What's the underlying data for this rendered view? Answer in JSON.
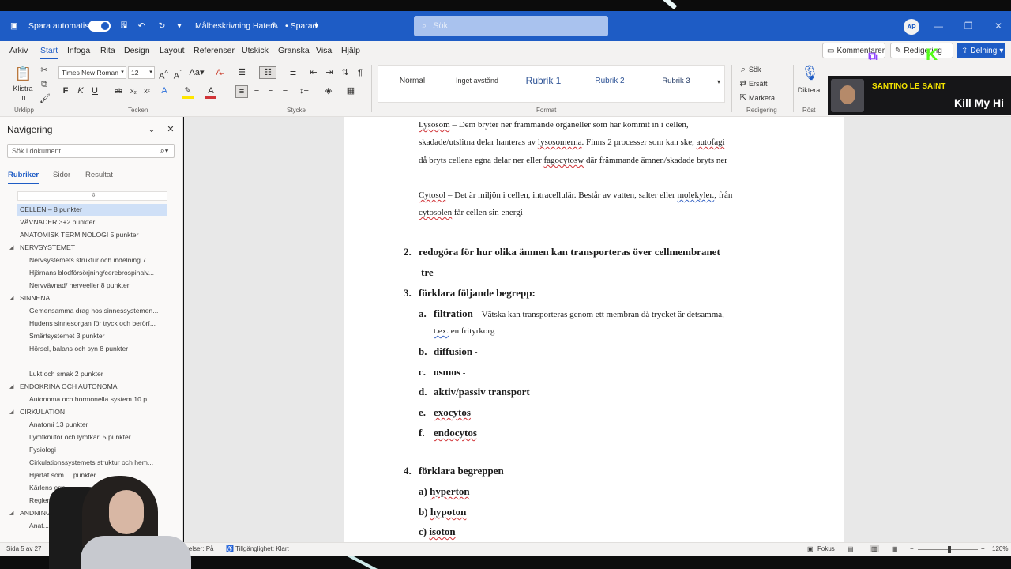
{
  "titlebar": {
    "autosave_label": "Spara automatiskt",
    "doc_title": "Målbeskrivning Hatem",
    "saved_state": "• Sparad",
    "search_placeholder": "Sök",
    "avatar_initials": "AP"
  },
  "menu": {
    "tabs": [
      "Arkiv",
      "Start",
      "Infoga",
      "Rita",
      "Design",
      "Layout",
      "Referenser",
      "Utskick",
      "Granska",
      "Visa",
      "Hjälp"
    ],
    "active_tab": "Start",
    "comments_label": "Kommentarer",
    "editing_label": "Redigering",
    "share_label": "Delning"
  },
  "ribbon": {
    "paste_label": "Klistra in",
    "groups": {
      "clipboard": "Urklipp",
      "font": "Tecken",
      "paragraph": "Stycke",
      "styles": "Format",
      "editing": "Redigering",
      "voice": "Röst"
    },
    "font_name": "Times New Roman",
    "font_size": "12",
    "styles": [
      "Normal",
      "Inget avstånd",
      "Rubrik 1",
      "Rubrik 2",
      "Rubrik 3"
    ],
    "find_label": "Sök",
    "replace_label": "Ersätt",
    "select_label": "Markera",
    "dictate_label": "Diktera"
  },
  "stream_overlay": {
    "artist": "SANTINO LE SAINT",
    "song": "Kill My Hi"
  },
  "nav": {
    "title": "Navigering",
    "search_placeholder": "Sök i dokument",
    "tabs": [
      "Rubriker",
      "Sidor",
      "Resultat"
    ],
    "items": [
      {
        "label": "",
        "level": 0,
        "caret": false,
        "selected": false
      },
      {
        "label": "CELLEN – 8 punkter",
        "level": 0,
        "caret": false,
        "selected": true
      },
      {
        "label": "VÄVNADER 3+2 punkter",
        "level": 0,
        "caret": false,
        "selected": false
      },
      {
        "label": "ANATOMISK TERMINOLOGI 5 punkter",
        "level": 0,
        "caret": false,
        "selected": false
      },
      {
        "label": "NERVSYSTEMET",
        "level": 0,
        "caret": true,
        "selected": false
      },
      {
        "label": "Nervsystemets struktur och indelning 7...",
        "level": 1,
        "caret": false,
        "selected": false
      },
      {
        "label": "Hjärnans blodförsörjning/cerebrospinalv...",
        "level": 1,
        "caret": false,
        "selected": false
      },
      {
        "label": "Nervvävnad/ nerveeller 8 punkter",
        "level": 1,
        "caret": false,
        "selected": false
      },
      {
        "label": "SINNENA",
        "level": 0,
        "caret": true,
        "selected": false
      },
      {
        "label": "Gemensamma drag hos sinnessystemen...",
        "level": 1,
        "caret": false,
        "selected": false
      },
      {
        "label": "Hudens sinnesorgan för tryck och berörí...",
        "level": 1,
        "caret": false,
        "selected": false
      },
      {
        "label": "Smärtsystemet 3 punkter",
        "level": 1,
        "caret": false,
        "selected": false
      },
      {
        "label": "Hörsel, balans och syn 8 punkter",
        "level": 1,
        "caret": false,
        "selected": false
      },
      {
        "label": "",
        "level": 1,
        "caret": false,
        "selected": false
      },
      {
        "label": "Lukt och smak 2 punkter",
        "level": 1,
        "caret": false,
        "selected": false
      },
      {
        "label": "ENDOKRINA OCH AUTONOMA",
        "level": 0,
        "caret": true,
        "selected": false
      },
      {
        "label": "Autonoma och hormonella system 10 p...",
        "level": 1,
        "caret": false,
        "selected": false
      },
      {
        "label": "CIRKULATION",
        "level": 0,
        "caret": true,
        "selected": false
      },
      {
        "label": "Anatomi 13 punkter",
        "level": 1,
        "caret": false,
        "selected": false
      },
      {
        "label": "Lymfknutor och lymfkärl 5 punkter",
        "level": 1,
        "caret": false,
        "selected": false
      },
      {
        "label": "Fysiologi",
        "level": 1,
        "caret": false,
        "selected": false
      },
      {
        "label": "Cirkulationssystemets struktur och hem...",
        "level": 1,
        "caret": false,
        "selected": false
      },
      {
        "label": "Hjärtat som ... punkter",
        "level": 1,
        "caret": false,
        "selected": false
      },
      {
        "label": "Kärlens ege...",
        "level": 1,
        "caret": false,
        "selected": false
      },
      {
        "label": "Reglering a... cirkula...",
        "level": 1,
        "caret": false,
        "selected": false
      },
      {
        "label": "ANDNING",
        "level": 0,
        "caret": true,
        "selected": false
      },
      {
        "label": "Anat...",
        "level": 1,
        "caret": false,
        "selected": false
      }
    ]
  },
  "document": {
    "lysosom_term": "Lysosom",
    "lysosom_l1": " – Dem bryter ner främmande organeller som har kommit in i cellen,",
    "lysosom_l2a": "skadade/utslitna delar hanteras av ",
    "lysosom_l2b": "lysosomerna",
    "lysosom_l2c": ". Finns 2 processer som kan ske, ",
    "lysosom_l2d": "autofagi",
    "lysosom_l3a": "då bryts cellens egna delar ner eller ",
    "lysosom_l3b": "fagocytosw",
    "lysosom_l3c": " där främmande ämnen/skadade bryts ner",
    "cytosol_term": "Cytosol",
    "cytosol_l1a": " – Det är miljön i cellen, intracellulär. Består av vatten, salter eller ",
    "cytosol_l1b": "molekyler.",
    "cytosol_l1c": ", från",
    "cytosol_l2a": "cytosolen",
    "cytosol_l2b": " får cellen sin energi",
    "q2_num": "2.",
    "q2_text": "redogöra för hur olika ämnen kan transporteras över cellmembranet",
    "q2_cont": "tre",
    "q3_num": "3.",
    "q3_text": "förklara följande begrepp:",
    "q3_items": [
      {
        "letter": "a.",
        "term": "filtration",
        "text": " – Vätska kan transporteras genom ett membran då trycket är detsamma,"
      },
      {
        "letter": "b.",
        "term": "diffusion",
        "text": " -"
      },
      {
        "letter": "c.",
        "term": "osmos",
        "text": " -"
      },
      {
        "letter": "d.",
        "term": "aktiv/passiv transport",
        "text": ""
      },
      {
        "letter": "e.",
        "term": "exocytos",
        "text": ""
      },
      {
        "letter": "f.",
        "term": "endocytos",
        "text": ""
      }
    ],
    "q3a_cont_a": "t.ex.",
    "q3a_cont_b": " en frityrkorg",
    "q4_num": "4.",
    "q4_text": "förklara begreppen",
    "q4_items": [
      {
        "prefix": "a) ",
        "term": "hyperton"
      },
      {
        "prefix": "b) ",
        "term": "hypoton"
      },
      {
        "prefix": "c) ",
        "term": "isoton"
      }
    ]
  },
  "status": {
    "page": "Sida 5 av 27",
    "prediction": "förutsägelser: På",
    "accessibility": "Tillgänglighet: Klart",
    "focus": "Fokus",
    "zoom": "120%"
  }
}
